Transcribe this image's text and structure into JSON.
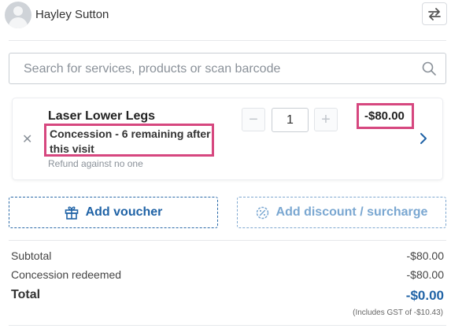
{
  "header": {
    "client_name": "Hayley Sutton",
    "swap_icon": "swap-arrows-icon"
  },
  "search": {
    "placeholder": "Search for services, products or scan barcode",
    "value": ""
  },
  "item": {
    "title": "Laser Lower Legs",
    "concession": "Concession - 6 remaining after this visit",
    "refund": "Refund against no one",
    "quantity": "1",
    "price": "-$80.00"
  },
  "actions": {
    "add_voucher": "Add voucher",
    "add_discount": "Add discount / surcharge"
  },
  "totals": {
    "subtotal_label": "Subtotal",
    "subtotal_value": "-$80.00",
    "concession_label": "Concession redeemed",
    "concession_value": "-$80.00",
    "total_label": "Total",
    "total_value": "-$0.00",
    "gst_note": "(Includes GST of -$10.43)"
  },
  "colors": {
    "accent": "#2063a6",
    "highlight": "#d6477f"
  }
}
